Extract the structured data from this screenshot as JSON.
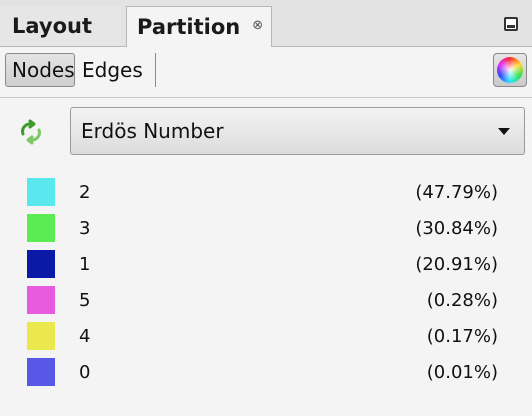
{
  "tabs": {
    "layout_label": "Layout",
    "partition_label": "Partition",
    "close_glyph": "⊗"
  },
  "mode": {
    "nodes_label": "Nodes",
    "edges_label": "Edges",
    "selected": "Nodes"
  },
  "attribute": {
    "selected": "Erdös Number"
  },
  "partitions": [
    {
      "value": "2",
      "percent": "(47.79%)",
      "color": "#5ae8ef"
    },
    {
      "value": "3",
      "percent": "(30.84%)",
      "color": "#5beb52"
    },
    {
      "value": "1",
      "percent": "(20.91%)",
      "color": "#0b1aa6"
    },
    {
      "value": "5",
      "percent": "(0.28%)",
      "color": "#e85ae0"
    },
    {
      "value": "4",
      "percent": "(0.17%)",
      "color": "#ebe84e"
    },
    {
      "value": "0",
      "percent": "(0.01%)",
      "color": "#5858e6"
    }
  ]
}
